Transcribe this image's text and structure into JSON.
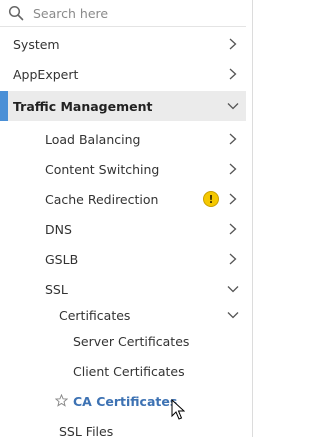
{
  "search": {
    "placeholder": "Search here",
    "value": "",
    "icon": "search-icon"
  },
  "nav": {
    "system": "System",
    "appexpert": "AppExpert",
    "traffic_management": "Traffic Management",
    "load_balancing": "Load Balancing",
    "content_switching": "Content Switching",
    "cache_redirection": "Cache Redirection",
    "cache_warning": "!",
    "dns": "DNS",
    "gslb": "GSLB",
    "ssl": "SSL",
    "certificates": "Certificates",
    "server_certificates": "Server Certificates",
    "client_certificates": "Client Certificates",
    "ca_certificates": "CA Certificates",
    "ssl_files": "SSL Files"
  },
  "colors": {
    "accent": "#4a8fd6",
    "active_text": "#3d72b3",
    "warning": "#f5c800",
    "selected_bg": "#ebebeb"
  }
}
